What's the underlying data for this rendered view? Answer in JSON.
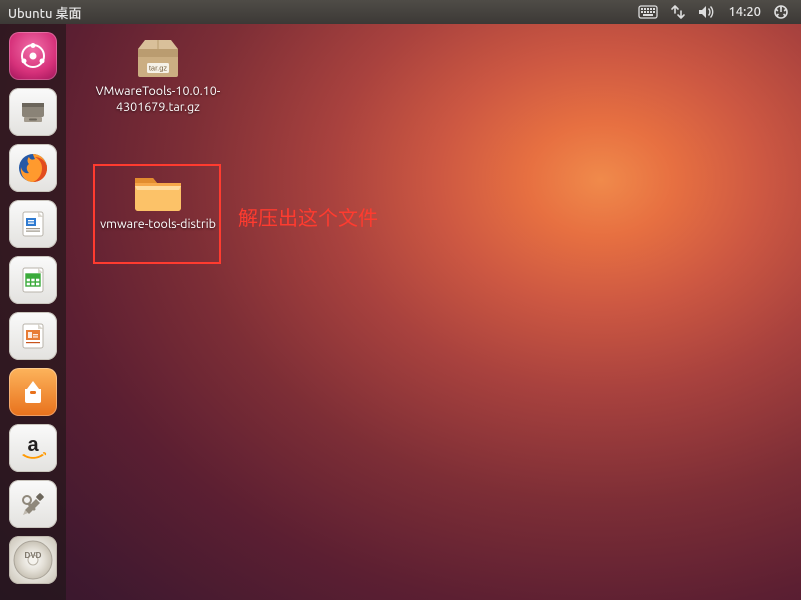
{
  "top_panel": {
    "title": "Ubuntu 桌面",
    "time": "14:20"
  },
  "launcher": {
    "items": [
      {
        "name": "dash",
        "label": "Dash"
      },
      {
        "name": "files",
        "label": "Files"
      },
      {
        "name": "firefox",
        "label": "Firefox"
      },
      {
        "name": "writer",
        "label": "LibreOffice Writer"
      },
      {
        "name": "calc",
        "label": "LibreOffice Calc"
      },
      {
        "name": "impress",
        "label": "LibreOffice Impress"
      },
      {
        "name": "software",
        "label": "Ubuntu Software"
      },
      {
        "name": "amazon",
        "label": "Amazon"
      },
      {
        "name": "settings",
        "label": "System Settings"
      },
      {
        "name": "disc",
        "label": "DVD Drive"
      }
    ]
  },
  "desktop": {
    "icons": [
      {
        "name": "vmwaretools-archive",
        "label": "VMwareTools-10.0.10-4301679.tar.gz",
        "icon_badge": "tar.gz"
      },
      {
        "name": "vmware-tools-distrib",
        "label": "vmware-tools-distrib"
      }
    ]
  },
  "annotation": {
    "text": "解压出这个文件",
    "highlight_color": "#ff3b2f"
  }
}
